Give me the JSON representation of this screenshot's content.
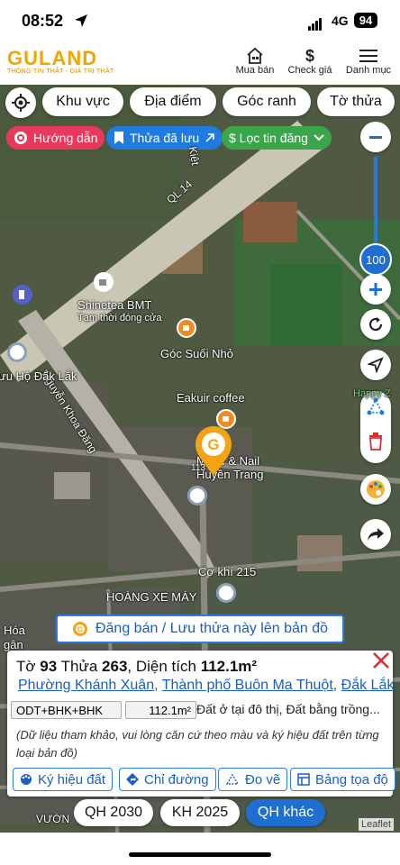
{
  "status_bar": {
    "time": "08:52",
    "network": "4G",
    "battery": "94"
  },
  "header": {
    "logo_text": "GULAND",
    "logo_tagline": "THÔNG TIN THẬT - GIÁ TRỊ THẬT",
    "buttons": [
      {
        "label": "Mua bán",
        "icon": "house-icon"
      },
      {
        "label": "Check giá",
        "icon": "dollar-icon"
      },
      {
        "label": "Danh mục",
        "icon": "menu-icon"
      }
    ]
  },
  "map": {
    "filter_chips": [
      "Khu vực",
      "Địa điểm",
      "Góc ranh",
      "Tờ thửa"
    ],
    "action_pills": [
      {
        "label": "Hướng dẫn",
        "color": "#e8395c"
      },
      {
        "label": "Thửa đã lưu",
        "color": "#1f7be0"
      },
      {
        "label": "$ Lọc tin đăng",
        "color": "#3aa54b"
      }
    ],
    "zoom_level": "100",
    "labels": {
      "road_ql14": "QL 14",
      "road_nkd": "Nguyễn Khoa Đăng",
      "shinetea": "Shinetea BMT",
      "shinetea_sub": "Tạm thời đóng cửa",
      "goc_suoi_nho": "Góc Suối Nhỏ",
      "ho_dak_lak": "ưu Hộ Đắk Lắk",
      "eakuir": "Eakuir coffee",
      "makeup": "Make  & Nail",
      "makeup2": "Huyền Trang",
      "co_khi": "Cơ khí 215",
      "hoang_xe_may": "HOÀNG XE MÁY",
      "hoa_ngan": "Hóa",
      "hoa_ngan2": "gân",
      "viet": "Kiệt",
      "happy": "Happy Z",
      "vuon": "VƯỜN",
      "marker_num": "113"
    },
    "save_bar": "Đăng bán / Lưu thửa này lên bản đồ"
  },
  "parcel": {
    "sheet_label": "Tờ",
    "sheet": "93",
    "plot_label": "Thửa",
    "plot": "263",
    "area_label": "Diện tích",
    "area": "112.1m²",
    "ward": "Phường Khánh Xuân",
    "city": "Thành phố Buôn Ma Thuột",
    "province": "Đắk Lắk",
    "land_code": "ODT+BHK+BHK",
    "land_area": "112.1m²",
    "land_type": "Đất ở tại đô thị, Đất bằng trồng...",
    "note": "(Dữ liệu tham khảo, vui lòng căn cứ theo màu và ký hiệu đất trên từng loại bản đồ)",
    "actions": [
      "Ký hiệu đất",
      "Chỉ đường",
      "Đo vẽ",
      "Bảng tọa độ"
    ]
  },
  "plans": [
    {
      "label": "QH 2030",
      "active": false
    },
    {
      "label": "KH 2025",
      "active": false
    },
    {
      "label": "QH khác",
      "active": true
    }
  ],
  "attribution": "Leaflet"
}
